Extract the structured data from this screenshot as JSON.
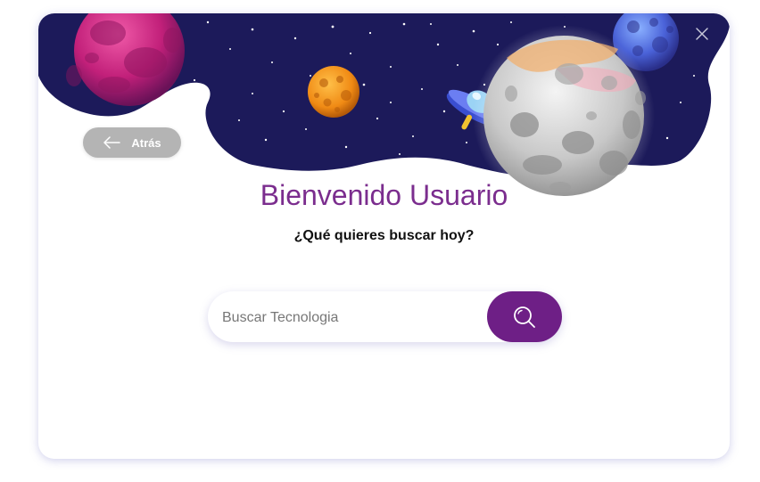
{
  "header": {
    "back_label": "Atrás"
  },
  "main": {
    "title": "Bienvenido Usuario",
    "subtitle": "¿Qué quieres buscar hoy?"
  },
  "search": {
    "placeholder": "Buscar Tecnologia",
    "value": ""
  },
  "colors": {
    "accent": "#6e1f86",
    "title": "#7b2d8e",
    "space_bg": "#1c1a5a",
    "back_button": "#b4b4b4"
  },
  "icons": {
    "close": "close-icon",
    "back": "arrow-left-icon",
    "search": "search-icon"
  }
}
